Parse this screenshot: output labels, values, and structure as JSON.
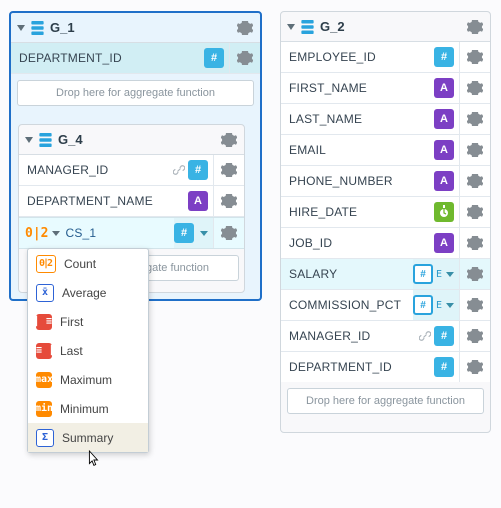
{
  "groups": {
    "g1": {
      "title": "G_1",
      "rows": [
        {
          "label": "DEPARTMENT_ID",
          "type": "num",
          "sel": true
        }
      ],
      "drop": "Drop here for aggregate function"
    },
    "g4": {
      "title": "G_4",
      "rows": [
        {
          "label": "MANAGER_ID",
          "type": "num",
          "link": true
        },
        {
          "label": "DEPARTMENT_NAME",
          "type": "str"
        }
      ],
      "cs": {
        "label": "CS_1"
      },
      "drop_trunc": "gate function"
    },
    "g2": {
      "title": "G_2",
      "rows": [
        {
          "label": "EMPLOYEE_ID",
          "type": "num"
        },
        {
          "label": "FIRST_NAME",
          "type": "str"
        },
        {
          "label": "LAST_NAME",
          "type": "str"
        },
        {
          "label": "EMAIL",
          "type": "str"
        },
        {
          "label": "PHONE_NUMBER",
          "type": "str"
        },
        {
          "label": "HIRE_DATE",
          "type": "date"
        },
        {
          "label": "JOB_ID",
          "type": "str"
        },
        {
          "label": "SALARY",
          "type": "numf",
          "sel": true,
          "drop": true,
          "e": true
        },
        {
          "label": "COMMISSION_PCT",
          "type": "numf",
          "drop": true,
          "e": true
        },
        {
          "label": "MANAGER_ID",
          "type": "num",
          "link": true
        },
        {
          "label": "DEPARTMENT_ID",
          "type": "num"
        }
      ],
      "drop": "Drop here for aggregate function"
    }
  },
  "menu": {
    "items": [
      {
        "label": "Count",
        "icon": "count"
      },
      {
        "label": "Average",
        "icon": "avg"
      },
      {
        "label": "First",
        "icon": "first"
      },
      {
        "label": "Last",
        "icon": "last"
      },
      {
        "label": "Maximum",
        "icon": "max"
      },
      {
        "label": "Minimum",
        "icon": "min"
      },
      {
        "label": "Summary",
        "icon": "sum",
        "hover": true
      }
    ]
  }
}
